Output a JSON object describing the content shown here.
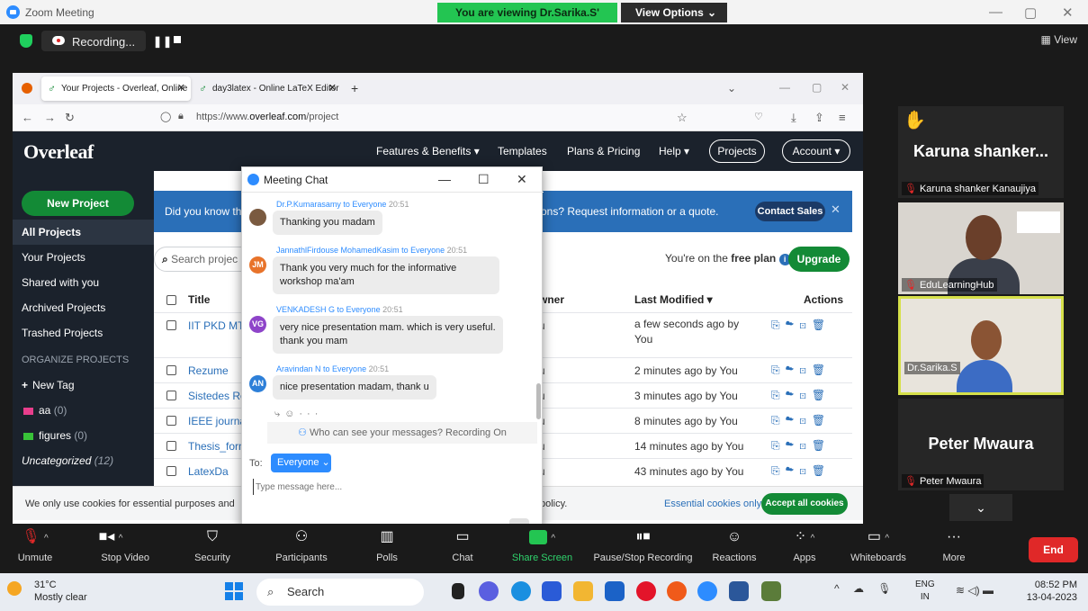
{
  "zoom": {
    "window_title": "Zoom Meeting",
    "viewing_banner": "You are viewing Dr.Sarika.S' screen",
    "view_options": "View Options",
    "recording_label": "Recording...",
    "view_label": "View"
  },
  "browser": {
    "tabs": [
      {
        "label": "Your Projects - Overleaf, Online"
      },
      {
        "label": "day3latex - Online LaTeX Editor"
      }
    ],
    "url_prefix": "https://www.",
    "url_domain": "overleaf.com",
    "url_path": "/project"
  },
  "overleaf": {
    "logo": "Overleaf",
    "nav": [
      "Features & Benefits ▾",
      "Templates",
      "Plans & Pricing",
      "Help ▾"
    ],
    "projects_btn": "Projects",
    "account_btn": "Account ▾",
    "new_project": "New Project",
    "sidebar": [
      "All Projects",
      "Your Projects",
      "Shared with you",
      "Archived Projects",
      "Trashed Projects"
    ],
    "organize_heading": "ORGANIZE PROJECTS",
    "new_tag": "New Tag",
    "tags": [
      {
        "name": "aa",
        "count": "(0)",
        "color": "#e83e8c"
      },
      {
        "name": "figures",
        "count": "(0)",
        "color": "#38c238"
      }
    ],
    "uncategorized": "Uncategorized",
    "uncategorized_count": "(12)",
    "banner_left": "Did you know th",
    "banner_right": "ons? Request information or a quote.",
    "contact_sales": "Contact Sales",
    "search_placeholder": "Search projec",
    "plan_text_1": "You're on the ",
    "plan_text_bold": "free plan",
    "upgrade": "Upgrade",
    "headers": {
      "title": "Title",
      "owner": "wner",
      "last_modified": "Last Modified ▾",
      "actions": "Actions"
    },
    "projects": [
      {
        "title": "IIT PKD MT",
        "owner": "u",
        "modified": "a few seconds ago by You"
      },
      {
        "title": "Rezume",
        "owner": "u",
        "modified": "2 minutes ago by You"
      },
      {
        "title": "Sistedes Re",
        "owner": "u",
        "modified": "3 minutes ago by You"
      },
      {
        "title": "IEEE journa",
        "owner": "u",
        "modified": "8 minutes ago by You"
      },
      {
        "title": "Thesis_form",
        "owner": "u",
        "modified": "14 minutes ago by You"
      },
      {
        "title": "LatexDa",
        "owner": "u",
        "modified": "43 minutes ago by You"
      }
    ],
    "cookie_text": "We only use cookies for essential purposes and",
    "cookie_text_2": "policy.",
    "essential_only": "Essential cookies only",
    "accept_all": "Accept all cookies"
  },
  "chat": {
    "title": "Meeting Chat",
    "messages": [
      {
        "from": "Dr.P.Kumarasamy",
        "to": "to Everyone",
        "time": "20:51",
        "text": "Thanking you madam",
        "initials": "",
        "color": "#7a5a40"
      },
      {
        "from": "JannathlFirdouse MohamedKasim",
        "to": "to Everyone",
        "time": "20:51",
        "text": "Thank you very much for the informative workshop ma'am",
        "initials": "JM",
        "color": "#e8732a"
      },
      {
        "from": "VENKADESH G",
        "to": "to Everyone",
        "time": "20:51",
        "text": "very nice presentation mam. which is very useful. thank you mam",
        "initials": "VG",
        "color": "#8e44c9"
      },
      {
        "from": "Aravindan N",
        "to": "to Everyone",
        "time": "20:51",
        "text": "nice presentation madam, thank u",
        "initials": "AN",
        "color": "#2d7fd8"
      }
    ],
    "who_can_see": "Who can see your messages? Recording On",
    "to_label": "To:",
    "recipient": "Everyone",
    "input_placeholder": "Type message here..."
  },
  "participants": {
    "p1_big": "Karuna shanker...",
    "p1_name": "Karuna shanker Kanaujiya",
    "p2_name": "EduLearningHub",
    "p3_name": "Dr.Sarika.S",
    "p4_big": "Peter Mwaura",
    "p4_name": "Peter Mwaura"
  },
  "toolbar": {
    "items": [
      "Unmute",
      "Stop Video",
      "Security",
      "Participants",
      "Polls",
      "Chat",
      "Share Screen",
      "Pause/Stop Recording",
      "Reactions",
      "Apps",
      "Whiteboards",
      "More"
    ],
    "end": "End"
  },
  "taskbar": {
    "temp": "31°C",
    "weather": "Mostly clear",
    "search": "Search",
    "lang1": "ENG",
    "lang2": "IN",
    "time": "08:52 PM",
    "date": "13-04-2023"
  }
}
